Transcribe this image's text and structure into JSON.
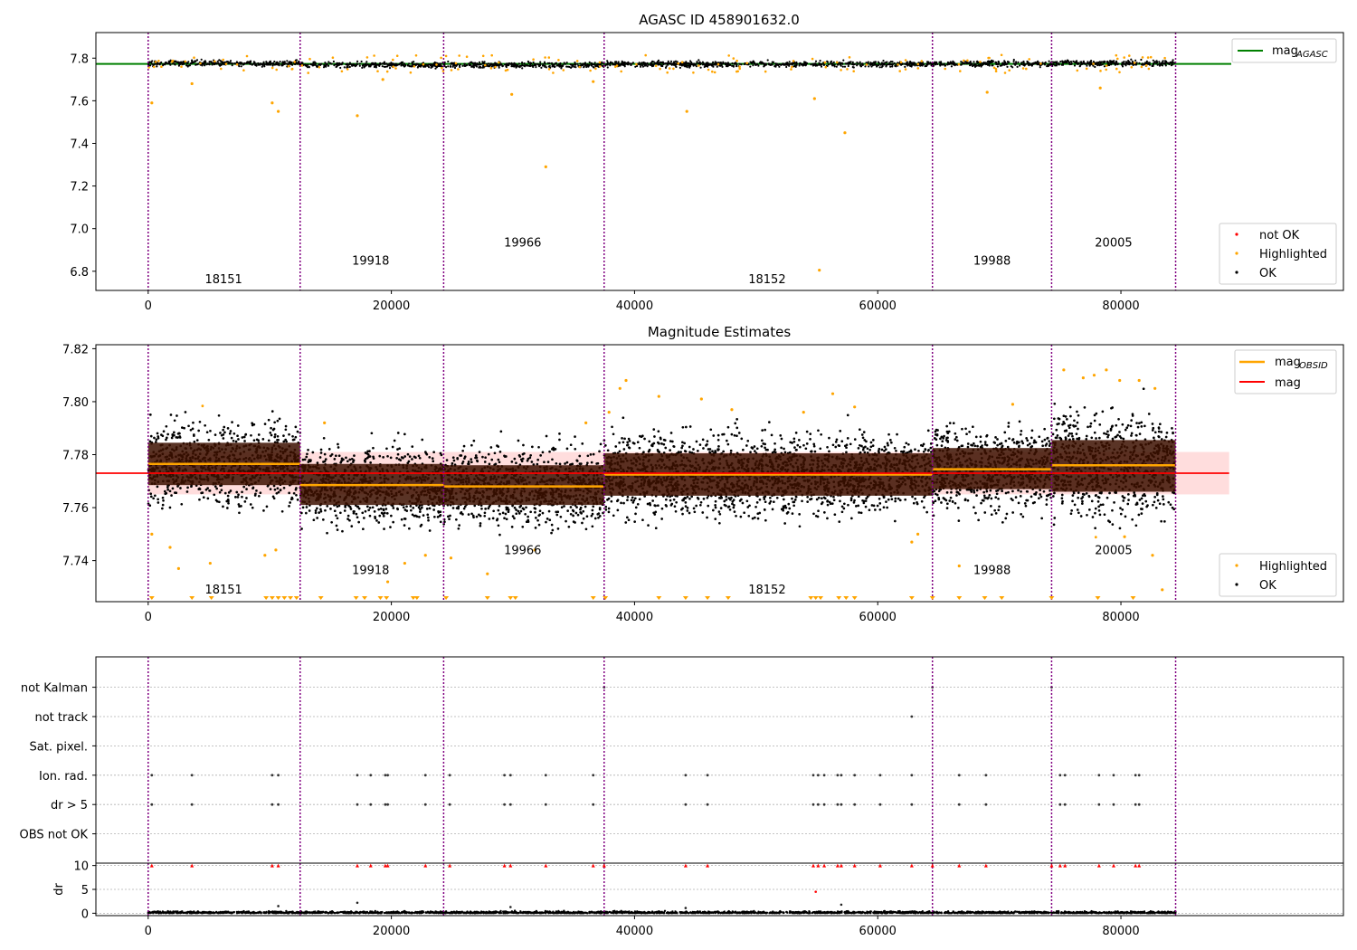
{
  "chart_data": [
    {
      "id": "p1",
      "type": "scatter",
      "title": "AGASC ID 458901632.0",
      "xlim": [
        -4300,
        98300
      ],
      "ylim": [
        6.71,
        7.92
      ],
      "xticks": [
        0,
        20000,
        40000,
        60000,
        80000
      ],
      "xtick_labels": [
        "0",
        "20000",
        "40000",
        "60000",
        "80000"
      ],
      "yticks": [
        6.8,
        7.0,
        7.2,
        7.4,
        7.6,
        7.8
      ],
      "ytick_labels": [
        "6.8",
        "7.0",
        "7.2",
        "7.4",
        "7.6",
        "7.8"
      ],
      "grid": false,
      "obsid_boundaries": [
        0,
        12500,
        24300,
        37500,
        64500,
        74300,
        84500
      ],
      "obsid_labels": [
        {
          "text": "18151",
          "x": 6200,
          "y": 6.745
        },
        {
          "text": "19918",
          "x": 18300,
          "y": 6.83
        },
        {
          "text": "19966",
          "x": 30800,
          "y": 6.915
        },
        {
          "text": "18152",
          "x": 50900,
          "y": 6.745
        },
        {
          "text": "19988",
          "x": 69400,
          "y": 6.83
        },
        {
          "text": "20005",
          "x": 79400,
          "y": 6.915
        }
      ],
      "mag_agasc": 7.773,
      "segment_levels": [
        {
          "x0": 0,
          "x1": 12500,
          "mag": 7.776
        },
        {
          "x0": 12500,
          "x1": 24300,
          "mag": 7.768
        },
        {
          "x0": 24300,
          "x1": 37500,
          "mag": 7.768
        },
        {
          "x0": 37500,
          "x1": 64500,
          "mag": 7.772
        },
        {
          "x0": 64500,
          "x1": 74300,
          "mag": 7.774
        },
        {
          "x0": 74300,
          "x1": 84500,
          "mag": 7.776
        }
      ],
      "highlighted_points": [
        [
          300,
          7.59
        ],
        [
          3600,
          7.68
        ],
        [
          10200,
          7.59
        ],
        [
          10700,
          7.55
        ],
        [
          17200,
          7.53
        ],
        [
          19300,
          7.7
        ],
        [
          29900,
          7.63
        ],
        [
          32700,
          7.29
        ],
        [
          36600,
          7.69
        ],
        [
          44300,
          7.55
        ],
        [
          54800,
          7.61
        ],
        [
          55200,
          6.805
        ],
        [
          57300,
          7.45
        ],
        [
          69000,
          7.64
        ],
        [
          78300,
          7.66
        ]
      ],
      "legend_upper": [
        {
          "label": "mag",
          "subscript": "AGASC",
          "color": "#008000"
        }
      ],
      "legend_lower": [
        {
          "label": "not OK",
          "color": "#ff0000"
        },
        {
          "label": "Highlighted",
          "color": "#ffa500"
        },
        {
          "label": "OK",
          "color": "#000000"
        }
      ]
    },
    {
      "id": "p2",
      "type": "scatter",
      "title": "Magnitude Estimates",
      "xlim": [
        -4300,
        98300
      ],
      "ylim": [
        7.7245,
        7.8215
      ],
      "xticks": [
        0,
        20000,
        40000,
        60000,
        80000
      ],
      "xtick_labels": [
        "0",
        "20000",
        "40000",
        "60000",
        "80000"
      ],
      "yticks": [
        7.74,
        7.76,
        7.78,
        7.8,
        7.82
      ],
      "ytick_labels": [
        "7.74",
        "7.76",
        "7.78",
        "7.80",
        "7.82"
      ],
      "grid": false,
      "obsid_boundaries": [
        0,
        12500,
        24300,
        37500,
        64500,
        74300,
        84500
      ],
      "obsid_labels": [
        {
          "text": "18151",
          "x": 6200,
          "y": 7.7275
        },
        {
          "text": "19918",
          "x": 18300,
          "y": 7.735
        },
        {
          "text": "19966",
          "x": 30800,
          "y": 7.7425
        },
        {
          "text": "18152",
          "x": 50900,
          "y": 7.7275
        },
        {
          "text": "19988",
          "x": 69400,
          "y": 7.735
        },
        {
          "text": "20005",
          "x": 79400,
          "y": 7.7425
        }
      ],
      "mag": 7.773,
      "mag_band": [
        7.765,
        7.781
      ],
      "mag_band_x": [
        0,
        88900
      ],
      "segments": [
        {
          "x0": 0,
          "x1": 12500,
          "mag": 7.7765,
          "lo": 7.7685,
          "hi": 7.7845,
          "ok_lo": 7.757,
          "ok_hi": 7.795
        },
        {
          "x0": 12500,
          "x1": 24300,
          "mag": 7.7685,
          "lo": 7.761,
          "hi": 7.7765,
          "ok_lo": 7.751,
          "ok_hi": 7.787
        },
        {
          "x0": 24300,
          "x1": 37500,
          "mag": 7.768,
          "lo": 7.761,
          "hi": 7.776,
          "ok_lo": 7.751,
          "ok_hi": 7.787
        },
        {
          "x0": 37500,
          "x1": 64500,
          "mag": 7.7725,
          "lo": 7.7645,
          "hi": 7.7805,
          "ok_lo": 7.755,
          "ok_hi": 7.793
        },
        {
          "x0": 64500,
          "x1": 74300,
          "mag": 7.7745,
          "lo": 7.767,
          "hi": 7.7825,
          "ok_lo": 7.757,
          "ok_hi": 7.797
        },
        {
          "x0": 74300,
          "x1": 84500,
          "mag": 7.776,
          "lo": 7.766,
          "hi": 7.7855,
          "ok_lo": 7.753,
          "ok_hi": 7.802
        }
      ],
      "highlighted_points": [
        [
          300,
          7.75
        ],
        [
          1800,
          7.745
        ],
        [
          2500,
          7.737
        ],
        [
          5100,
          7.739
        ],
        [
          9600,
          7.742
        ],
        [
          10500,
          7.744
        ],
        [
          14500,
          7.792
        ],
        [
          19700,
          7.732
        ],
        [
          21100,
          7.739
        ],
        [
          22800,
          7.742
        ],
        [
          24900,
          7.741
        ],
        [
          27900,
          7.735
        ],
        [
          31800,
          7.744
        ],
        [
          36000,
          7.792
        ],
        [
          37900,
          7.796
        ],
        [
          38800,
          7.805
        ],
        [
          39300,
          7.808
        ],
        [
          42000,
          7.802
        ],
        [
          45500,
          7.801
        ],
        [
          48000,
          7.797
        ],
        [
          53900,
          7.796
        ],
        [
          56300,
          7.803
        ],
        [
          58100,
          7.798
        ],
        [
          62800,
          7.747
        ],
        [
          63300,
          7.75
        ],
        [
          66700,
          7.738
        ],
        [
          71100,
          7.799
        ],
        [
          75300,
          7.812
        ],
        [
          76900,
          7.809
        ],
        [
          77800,
          7.81
        ],
        [
          78800,
          7.812
        ],
        [
          79900,
          7.808
        ],
        [
          81500,
          7.808
        ],
        [
          82800,
          7.805
        ],
        [
          80300,
          7.749
        ],
        [
          82600,
          7.742
        ],
        [
          83400,
          7.729
        ]
      ],
      "clipped_x": [
        300,
        3600,
        5200,
        9700,
        10200,
        10700,
        11200,
        11700,
        12200,
        14200,
        17100,
        17800,
        19100,
        19600,
        21800,
        22100,
        24500,
        27900,
        29800,
        30200,
        36600,
        37600,
        42000,
        44200,
        46000,
        47700,
        54500,
        54900,
        55300,
        56800,
        57400,
        58100,
        62800,
        64500,
        66700,
        68800,
        70200,
        74300,
        78100,
        81000
      ],
      "legend_upper": [
        {
          "label": "mag",
          "subscript": "OBSID",
          "color": "#ffa500"
        },
        {
          "label": "mag",
          "subscript": "",
          "color": "#ff0000"
        }
      ],
      "legend_lower": [
        {
          "label": "Highlighted",
          "color": "#ffa500"
        },
        {
          "label": "OK",
          "color": "#000000"
        }
      ]
    },
    {
      "id": "p3",
      "type": "scatter",
      "xlim": [
        -4300,
        98300
      ],
      "categories": [
        "OBS not OK",
        "dr > 5",
        "Ion. rad.",
        "Sat. pixel.",
        "not track",
        "not Kalman"
      ],
      "flag_events": {
        "Ion. rad.": [
          300,
          3600,
          10200,
          10700,
          17200,
          18300,
          19500,
          19700,
          22800,
          24800,
          29300,
          29800,
          32700,
          36600,
          44200,
          46000,
          54700,
          55100,
          55600,
          56700,
          57000,
          58100,
          60200,
          62800,
          66700,
          68900,
          75000,
          75400,
          78200,
          79400,
          81200,
          81500
        ],
        "dr > 5": [
          300,
          3600,
          10200,
          10700,
          17200,
          18300,
          19500,
          19700,
          22800,
          24800,
          29300,
          29800,
          32700,
          36600,
          44200,
          46000,
          54700,
          55100,
          55600,
          56700,
          57000,
          58100,
          60200,
          62800,
          66700,
          68900,
          75000,
          75400,
          78200,
          79400,
          81200,
          81500
        ],
        "not track": [
          62800
        ],
        "not Kalman": [
          37500,
          64500,
          74300
        ]
      },
      "xticks": [
        0,
        20000,
        40000,
        60000,
        80000
      ],
      "xtick_labels": [
        "0",
        "20000",
        "40000",
        "60000",
        "80000"
      ],
      "dr_panel": {
        "ylabel": "dr",
        "ylim": [
          -0.5,
          10.5
        ],
        "yticks": [
          0,
          5,
          10
        ],
        "ytick_labels": [
          "0",
          "5",
          "10"
        ],
        "clipped_x": [
          300,
          3600,
          10200,
          10700,
          17200,
          18300,
          19500,
          19700,
          22800,
          24800,
          29300,
          29800,
          32700,
          36600,
          37500,
          44200,
          46000,
          54700,
          55100,
          55600,
          56700,
          57000,
          58100,
          60200,
          62800,
          64500,
          66700,
          68900,
          74300,
          75000,
          75400,
          78200,
          79400,
          81200,
          81500
        ],
        "outliers": [
          [
            10700,
            1.5
          ],
          [
            17200,
            2.2
          ],
          [
            29800,
            1.3
          ],
          [
            44200,
            1.1
          ],
          [
            54900,
            4.5
          ],
          [
            57000,
            1.8
          ]
        ]
      }
    }
  ],
  "colors": {
    "ok": "#000000",
    "highlighted": "#ffa500",
    "not_ok": "#ff0000",
    "agasc_line": "#008000",
    "mag_line": "#ff0000",
    "obsid_line": "#ffa500",
    "boundary": "#800080",
    "band": "#ffdddd",
    "seg_band": "#3d1000"
  }
}
